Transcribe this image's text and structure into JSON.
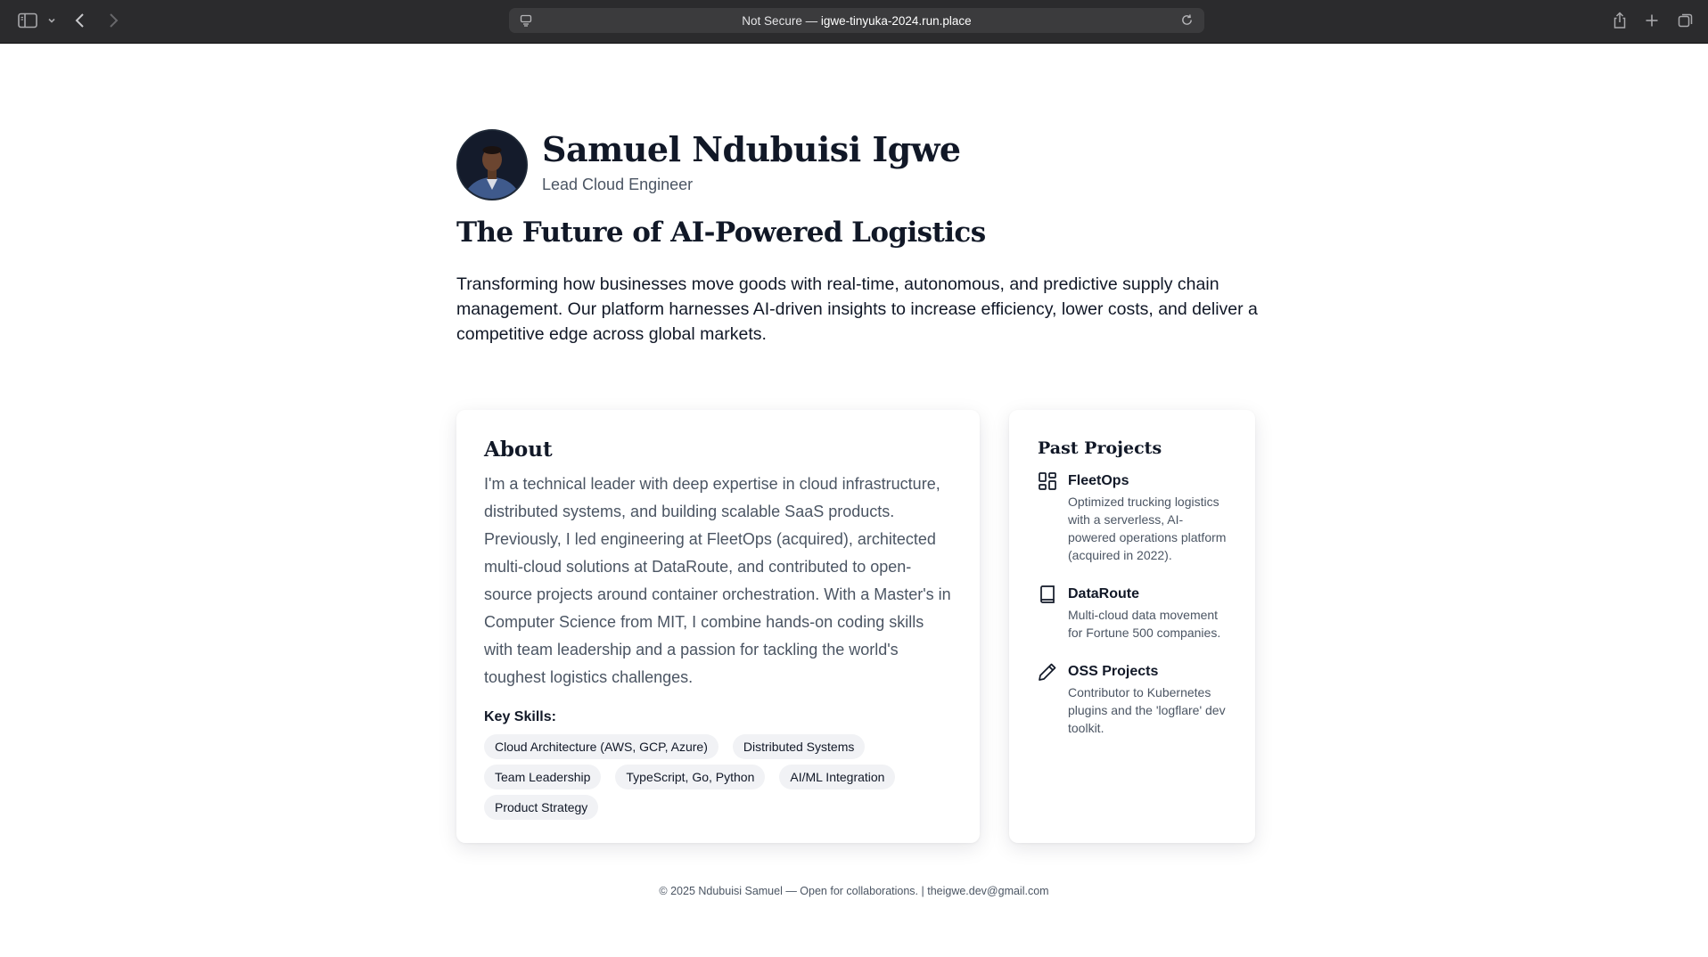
{
  "browser": {
    "url_prefix": "Not Secure — ",
    "url_host": "igwe-tinyuka-2024.run.place"
  },
  "profile": {
    "name": "Samuel Ndubuisi Igwe",
    "role": "Lead Cloud Engineer"
  },
  "hero": {
    "headline": "The Future of AI-Powered Logistics",
    "intro": "Transforming how businesses move goods with real-time, autonomous, and predictive supply chain management. Our platform harnesses AI-driven insights to increase efficiency, lower costs, and deliver a competitive edge across global markets."
  },
  "about": {
    "title": "About",
    "text": "I'm a technical leader with deep expertise in cloud infrastructure, distributed systems, and building scalable SaaS products. Previously, I led engineering at FleetOps (acquired), architected multi-cloud solutions at DataRoute, and contributed to open-source projects around container orchestration. With a Master's in Computer Science from MIT, I combine hands-on coding skills with team leadership and a passion for tackling the world's toughest logistics challenges.",
    "skills_label": "Key Skills:",
    "skills": [
      "Cloud Architecture (AWS, GCP, Azure)",
      "Distributed Systems",
      "Team Leadership",
      "TypeScript, Go, Python",
      "AI/ML Integration",
      "Product Strategy"
    ]
  },
  "projects": {
    "title": "Past Projects",
    "items": [
      {
        "name": "FleetOps",
        "description": "Optimized trucking logistics with a serverless, AI-powered operations platform (acquired in 2022).",
        "icon": "dashboard-grid-icon"
      },
      {
        "name": "DataRoute",
        "description": "Multi-cloud data movement for Fortune 500 companies.",
        "icon": "book-icon"
      },
      {
        "name": "OSS Projects",
        "description": "Contributor to Kubernetes plugins and the 'logflare' dev toolkit.",
        "icon": "pencil-icon"
      }
    ]
  },
  "footer": {
    "text": "© 2025 Ndubuisi Samuel — Open for collaborations. | theigwe.dev@gmail.com"
  }
}
